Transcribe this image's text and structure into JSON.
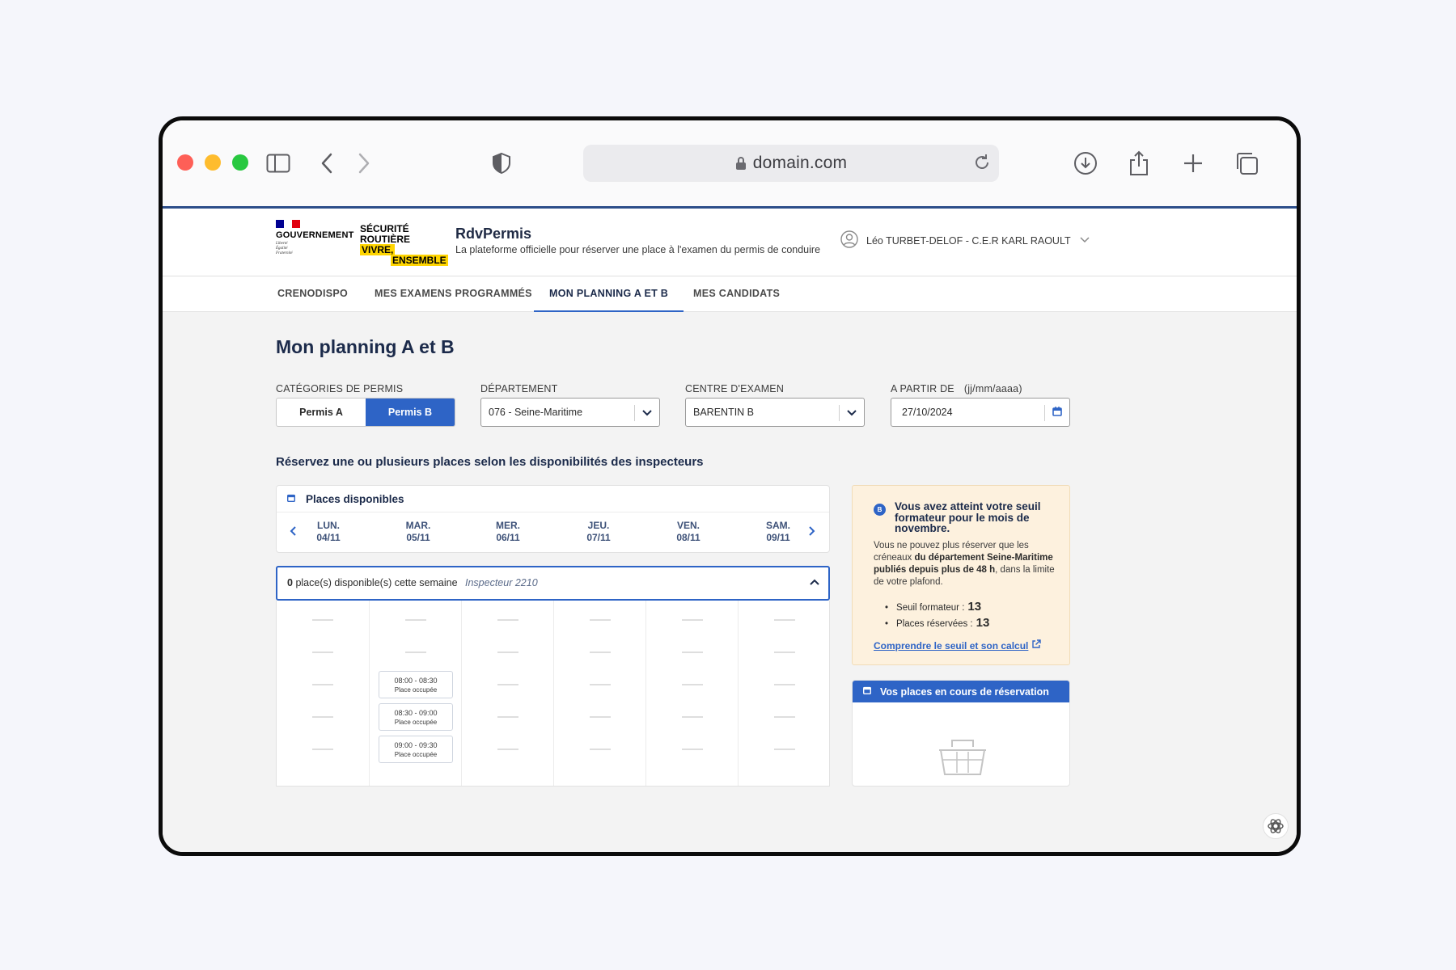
{
  "browser": {
    "url": "domain.com"
  },
  "header": {
    "gov_name": "GOUVERNEMENT",
    "gov_motto": [
      "Liberté",
      "Égalité",
      "Fraternité"
    ],
    "sr_line1": "SÉCURITÉ",
    "sr_line2": "ROUTIÈRE",
    "sr_vivre": "VIVRE,",
    "sr_ensemble": "ENSEMBLE",
    "site_title": "RdvPermis",
    "site_subtitle": "La plateforme officielle pour réserver une place à l'examen du permis de conduire",
    "user": "Léo TURBET-DELOF - C.E.R KARL RAOULT"
  },
  "nav": {
    "items": [
      "CRENODISPO",
      "MES EXAMENS PROGRAMMÉS",
      "MON PLANNING A ET B",
      "MES CANDIDATS"
    ],
    "active": "MON PLANNING A ET B"
  },
  "page": {
    "title": "Mon planning A et B",
    "filters": {
      "categories_label": "CATÉGORIES DE PERMIS",
      "permis_a": "Permis A",
      "permis_b": "Permis B",
      "selected_category": "Permis B",
      "departement_label": "DÉPARTEMENT",
      "departement_value": "076 - Seine-Maritime",
      "centre_label": "CENTRE D'EXAMEN",
      "centre_value": "BARENTIN B",
      "date_label": "A PARTIR DE",
      "date_hint": "(jj/mm/aaaa)",
      "date_value": "27/10/2024"
    },
    "section_heading": "Réservez une ou plusieurs places selon les disponibilités des inspecteurs",
    "week": {
      "title": "Places disponibles",
      "days": [
        {
          "name": "LUN.",
          "date": "04/11"
        },
        {
          "name": "MAR.",
          "date": "05/11"
        },
        {
          "name": "MER.",
          "date": "06/11"
        },
        {
          "name": "JEU.",
          "date": "07/11"
        },
        {
          "name": "VEN.",
          "date": "08/11"
        },
        {
          "name": "SAM.",
          "date": "09/11"
        }
      ]
    },
    "inspector": {
      "count": "0",
      "count_text": "place(s) disponible(s) cette semaine",
      "name": "Inspecteur 2210",
      "slots": [
        {
          "time": "08:00 - 08:30",
          "status": "Place occupée"
        },
        {
          "time": "08:30 - 09:00",
          "status": "Place occupée"
        },
        {
          "time": "09:00 - 09:30",
          "status": "Place occupée"
        }
      ]
    },
    "notice": {
      "badge": "B",
      "title": "Vous avez atteint votre seuil formateur pour le mois de novembre.",
      "body_start": "Vous ne pouvez plus réserver que les créneaux ",
      "body_bold": "du département Seine-Maritime publiés depuis plus de 48 h",
      "body_end": ", dans la limite de votre plafond.",
      "seuil_label": "Seuil formateur :",
      "seuil_value": "13",
      "places_label": "Places réservées :",
      "places_value": "13",
      "link": "Comprendre le seuil et son calcul"
    },
    "reservation_title": "Vos places en cours de réservation"
  },
  "colors": {
    "accent": "#2e64c6",
    "navy": "#1b2a4a",
    "notice_bg": "#fdf1de"
  }
}
